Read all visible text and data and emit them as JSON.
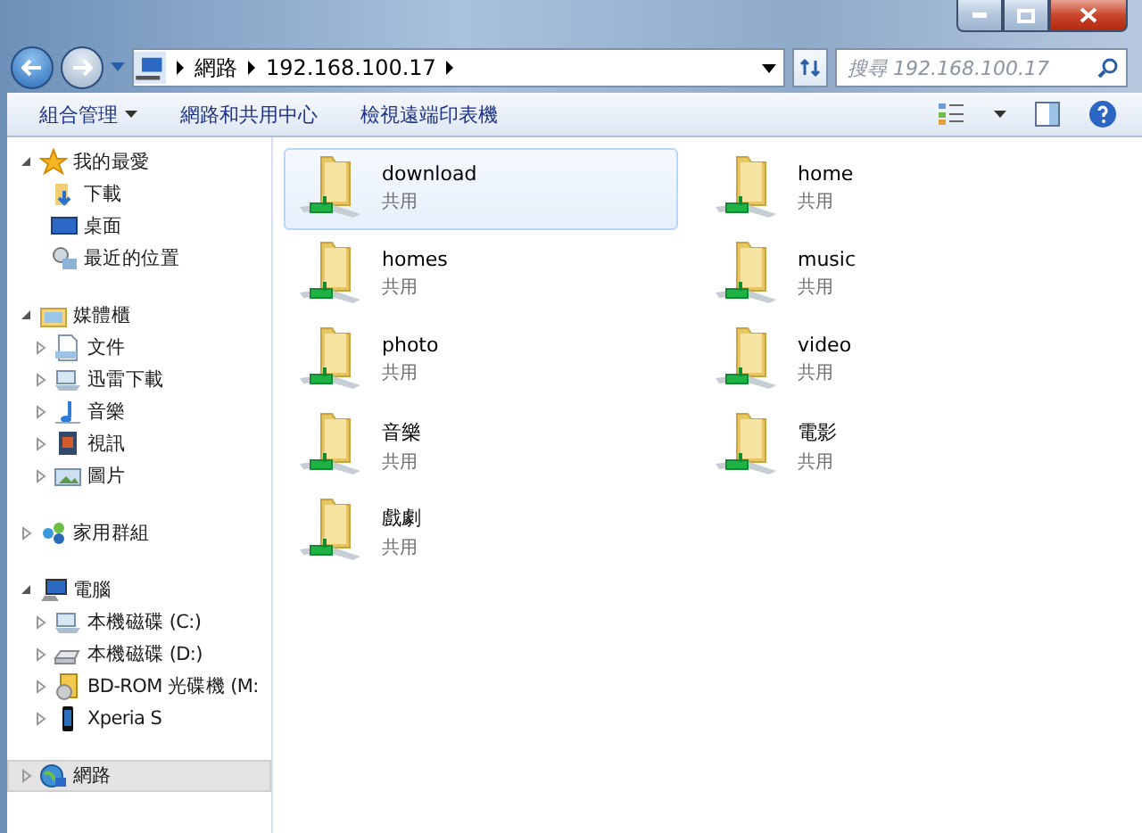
{
  "address_bar": {
    "segments": [
      "網路",
      "192.168.100.17"
    ]
  },
  "search": {
    "placeholder": "搜尋 192.168.100.17"
  },
  "toolbar": {
    "items": [
      {
        "label": "組合管理",
        "dropdown": true
      },
      {
        "label": "網路和共用中心",
        "dropdown": false
      },
      {
        "label": "檢視遠端印表機",
        "dropdown": false
      }
    ]
  },
  "sidebar": {
    "groups": [
      {
        "label": "我的最愛",
        "kind": "star",
        "expanded": true,
        "selected": false,
        "children": [
          {
            "label": "下載",
            "kind": "download"
          },
          {
            "label": "桌面",
            "kind": "desktop"
          },
          {
            "label": "最近的位置",
            "kind": "recent"
          }
        ]
      },
      {
        "label": "媒體櫃",
        "kind": "library",
        "expanded": true,
        "selected": false,
        "children": [
          {
            "label": "文件",
            "kind": "document",
            "expanded": false
          },
          {
            "label": "迅雷下載",
            "kind": "drive",
            "expanded": false
          },
          {
            "label": "音樂",
            "kind": "music",
            "expanded": false
          },
          {
            "label": "視訊",
            "kind": "video",
            "expanded": false
          },
          {
            "label": "圖片",
            "kind": "picture",
            "expanded": false
          }
        ]
      },
      {
        "label": "家用群組",
        "kind": "homegroup",
        "expanded": false,
        "selected": false
      },
      {
        "label": "電腦",
        "kind": "computer",
        "expanded": true,
        "selected": false,
        "children": [
          {
            "label": "本機磁碟 (C:)",
            "kind": "drive",
            "expanded": false
          },
          {
            "label": "本機磁碟 (D:)",
            "kind": "disk",
            "expanded": false
          },
          {
            "label": "BD-ROM 光碟機 (M:",
            "kind": "optical",
            "expanded": false
          },
          {
            "label": "Xperia S",
            "kind": "phone",
            "expanded": false
          }
        ]
      },
      {
        "label": "網路",
        "kind": "network",
        "expanded": false,
        "selected": true
      }
    ]
  },
  "shares": [
    {
      "name": "download",
      "type": "共用",
      "selected": true
    },
    {
      "name": "home",
      "type": "共用",
      "selected": false
    },
    {
      "name": "homes",
      "type": "共用",
      "selected": false
    },
    {
      "name": "music",
      "type": "共用",
      "selected": false
    },
    {
      "name": "photo",
      "type": "共用",
      "selected": false
    },
    {
      "name": "video",
      "type": "共用",
      "selected": false
    },
    {
      "name": "音樂",
      "type": "共用",
      "selected": false
    },
    {
      "name": "電影",
      "type": "共用",
      "selected": false
    },
    {
      "name": "戲劇",
      "type": "共用",
      "selected": false
    }
  ]
}
